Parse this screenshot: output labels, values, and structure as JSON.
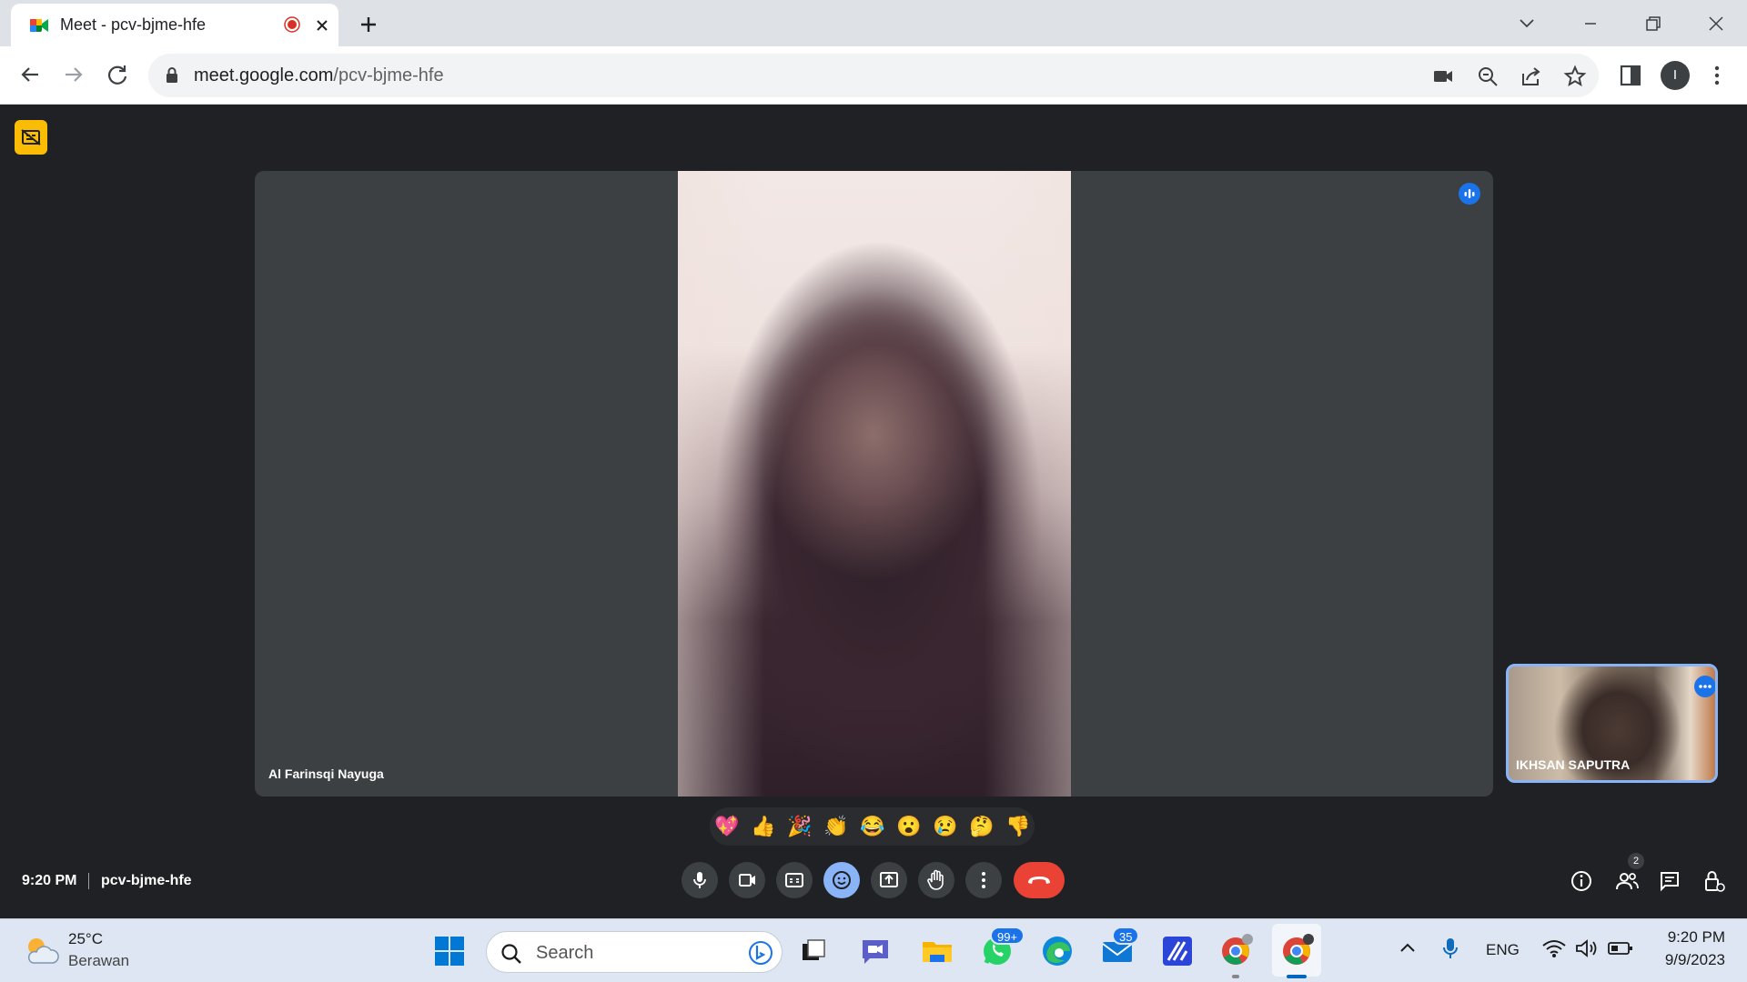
{
  "browser": {
    "tab": {
      "title": "Meet - pcv-bjme-hfe",
      "favicon": "google-meet-icon",
      "recording_indicator": "recording-icon"
    },
    "new_tab": "plus-icon",
    "url": {
      "host": "meet.google.com",
      "path": "/pcv-bjme-hfe"
    },
    "profile_initial": "I"
  },
  "meeting": {
    "main_participant": "Al Farinsqi Nayuga",
    "self_participant": "IKHSAN SAPUTRA",
    "time": "9:20 PM",
    "code": "pcv-bjme-hfe",
    "participant_count": "2",
    "reactions": [
      "💖",
      "👍",
      "🎉",
      "👏",
      "😂",
      "😮",
      "😢",
      "🤔",
      "👎"
    ]
  },
  "taskbar": {
    "weather": {
      "temp": "25°C",
      "desc": "Berawan"
    },
    "search_placeholder": "Search",
    "whatsapp_badge": "99+",
    "mail_badge": "35",
    "language": "ENG",
    "time": "9:20 PM",
    "date": "9/9/2023"
  },
  "colors": {
    "accent": "#1a73e8",
    "end_call": "#ea4335",
    "caption_badge": "#fbbc04",
    "meet_bg": "#202124"
  }
}
